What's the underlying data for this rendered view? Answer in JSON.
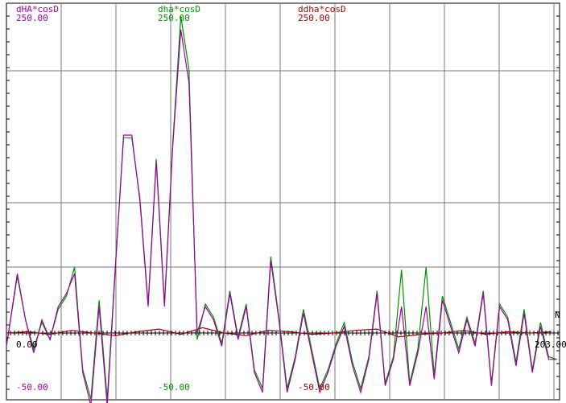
{
  "chart_data": {
    "type": "line",
    "grid": true,
    "ylim": [
      -50,
      250
    ],
    "x_origin_label": "0.00",
    "x_end_label": "203.00",
    "corner_marker": "N",
    "axis_labels": [
      {
        "name": "dHA*cosD",
        "top": "250.00",
        "bottom": "-50.00",
        "color": "#a000a0"
      },
      {
        "name": "dha*cosD",
        "top": "250.00",
        "bottom": "-50.00",
        "color": "#009000"
      },
      {
        "name": "ddha*cosD",
        "top": "250.00",
        "bottom": "-50.00",
        "color": "#a00000"
      }
    ],
    "series": [
      {
        "name": "dHA*cosD",
        "color": "#a000a0",
        "x": [
          0,
          4,
          7,
          10,
          13,
          16,
          19,
          22,
          25,
          28,
          31,
          34,
          37,
          40,
          43,
          46,
          49,
          52,
          55,
          58,
          61,
          64,
          67,
          70,
          73,
          76,
          79,
          82,
          85,
          88,
          91,
          94,
          97,
          100,
          103,
          106,
          109,
          112,
          115,
          118,
          121,
          124,
          127,
          130,
          133,
          136,
          139,
          142,
          145,
          148,
          151,
          154,
          157,
          160,
          163,
          166,
          169,
          172,
          175,
          178,
          181,
          184,
          187,
          190,
          193,
          196,
          199,
          202
        ],
        "values": [
          -10,
          45,
          10,
          -15,
          10,
          -5,
          20,
          30,
          45,
          -30,
          -55,
          20,
          -55,
          50,
          150,
          150,
          100,
          20,
          130,
          20,
          140,
          230,
          190,
          0,
          20,
          10,
          -10,
          30,
          -5,
          20,
          -30,
          -45,
          55,
          10,
          -45,
          -20,
          15,
          -15,
          -45,
          -30,
          -10,
          5,
          -25,
          -45,
          -20,
          30,
          -40,
          -20,
          20,
          -40,
          -15,
          20,
          -35,
          25,
          5,
          -15,
          10,
          -10,
          30,
          -40,
          20,
          10,
          -25,
          15,
          -30,
          5,
          -20,
          -20
        ]
      },
      {
        "name": "dha*cosD",
        "color": "#009000",
        "x": [
          0,
          4,
          7,
          10,
          13,
          16,
          19,
          22,
          25,
          28,
          31,
          34,
          37,
          40,
          43,
          46,
          49,
          52,
          55,
          58,
          61,
          64,
          67,
          70,
          73,
          76,
          79,
          82,
          85,
          88,
          91,
          94,
          97,
          100,
          103,
          106,
          109,
          112,
          115,
          118,
          121,
          124,
          127,
          130,
          133,
          136,
          139,
          142,
          145,
          148,
          151,
          154,
          157,
          160,
          163,
          166,
          169,
          172,
          175,
          178,
          181,
          184,
          187,
          190,
          193,
          196,
          199,
          202
        ],
        "values": [
          -10,
          43,
          10,
          -12,
          8,
          -5,
          18,
          28,
          50,
          -28,
          -50,
          25,
          -50,
          52,
          148,
          148,
          102,
          22,
          132,
          22,
          142,
          240,
          200,
          -5,
          22,
          12,
          -8,
          32,
          -3,
          22,
          -28,
          -42,
          58,
          12,
          -42,
          -18,
          18,
          -12,
          -42,
          -28,
          -8,
          8,
          -22,
          -42,
          -18,
          32,
          -38,
          -18,
          48,
          -38,
          -12,
          50,
          -32,
          28,
          8,
          -12,
          12,
          -8,
          32,
          -38,
          22,
          12,
          -22,
          18,
          -28,
          8,
          -18,
          -20
        ]
      },
      {
        "name": "ddha*cosD",
        "color": "#a00000",
        "x": [
          0,
          8,
          16,
          24,
          32,
          40,
          48,
          56,
          64,
          72,
          80,
          88,
          96,
          104,
          112,
          120,
          128,
          136,
          144,
          152,
          160,
          168,
          176,
          184,
          192,
          200
        ],
        "values": [
          0,
          1,
          -1,
          2,
          0,
          -2,
          1,
          3,
          -1,
          4,
          0,
          -2,
          2,
          1,
          -1,
          0,
          2,
          3,
          -3,
          -1,
          0,
          2,
          -1,
          1,
          0,
          1
        ]
      }
    ]
  }
}
